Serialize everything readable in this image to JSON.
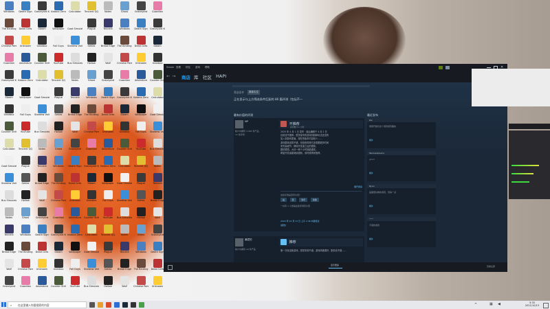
{
  "colors": {
    "steam_bg": "#1b2838",
    "steam_dark": "#171a21",
    "accent_red": "#c15755",
    "link_blue": "#66c0f4"
  },
  "desktop": {
    "icons": [
      {
        "label": "Windows",
        "color": "#4a7fc1"
      },
      {
        "label": "The Binding",
        "color": "#6a4a3a"
      },
      {
        "label": "Chinese Parents",
        "color": "#c44a4a"
      },
      {
        "label": "Guardian",
        "color": "#e87ca8"
      },
      {
        "label": "Graveyard Keeper",
        "color": "#3a3a3a"
      },
      {
        "label": "Steam",
        "color": "#1b2838"
      },
      {
        "label": "Gearbox",
        "color": "#333333"
      },
      {
        "label": "Counter Strike",
        "color": "#4a5a3a"
      },
      {
        "label": "Calculator",
        "color": "#ddddaa"
      },
      {
        "label": "Goat Simulator",
        "color": "#f0f0f0"
      },
      {
        "label": "Stardew Valley",
        "color": "#3a8fd8"
      },
      {
        "label": "Bus Simulator",
        "color": "#dddddd"
      },
      {
        "label": "Notes",
        "color": "#bbbbbb"
      },
      {
        "label": "Tencent",
        "color": "#3a3a6a"
      },
      {
        "label": "Bread Edge",
        "color": "#222222"
      },
      {
        "label": "Wolf",
        "color": "#e4e4e4"
      },
      {
        "label": "Graveyard",
        "color": "#444444"
      },
      {
        "label": "Death Sign",
        "color": "#3a7fc1"
      },
      {
        "label": "Dead Cells",
        "color": "#bb3333"
      },
      {
        "label": "Unknown",
        "color": "#ffcc33"
      },
      {
        "label": "Adventure",
        "color": "#2a5a9a"
      },
      {
        "label": "Katana Zero",
        "color": "#2a6ab0"
      },
      {
        "label": "Wallpaper",
        "color": "#111111"
      },
      {
        "label": "Fall Guys",
        "color": "#eeeeee"
      },
      {
        "label": "YouTube",
        "color": "#cc2b2b"
      },
      {
        "label": "Tencent QQ",
        "color": "#e0c030"
      },
      {
        "label": "Plague",
        "color": "#3a3a3a"
      },
      {
        "label": "Sekiro",
        "color": "#555555"
      },
      {
        "label": "Hollow",
        "color": "#222222"
      },
      {
        "label": "Ghost",
        "color": "#6aa0d0"
      }
    ]
  },
  "steam": {
    "topbar": {
      "items": [
        "Steam",
        "查看",
        "好友",
        "游戏",
        "帮助"
      ]
    },
    "nav": {
      "store": "商店",
      "library": "库",
      "community": "社区",
      "user": "HAPI"
    },
    "filter_label": "筛选条件",
    "filter_value": "简体中文",
    "filter_sentence": "正在显示与上方筛选条件匹配的 86 篇评测（包括不一",
    "section_most_helpful": "最有价值的评测",
    "section_recent": "最近发布",
    "review_main": {
      "user": "MP",
      "meta": "帐户内拥有 3,980 件产品",
      "sub_meta": "12 篇评测",
      "verdict": "不推荐",
      "hours": "总时数 0.1 小时",
      "body_lines": [
        "2020 年 4 月 1 日 发布 · 最后编辑于 4 月 2 日",
        "目前还不推荐，很多宣传的游戏机制和玩法还没有",
        "加入到游戏里面，现在的版本内容较少……",
        "游戏整体还算不错，但是我觉得它还需要更多时间",
        "来完善细节，期待开发者之后的更新。",
        "剧情很短，大约一两个小时就能通关。",
        "希望开发者能继续更新，到时候再来推荐。"
      ],
      "helpful_q": "这篇评测是否有价值？",
      "yes": "是",
      "no": "否",
      "funny": "欢乐",
      "award": "奖励",
      "read_more": "展开阅读",
      "footer_link": "一共有 1 人觉得这篇评测有价值",
      "date_footer": "2020 年 10 月 13 日 上午 2:46 内容经过",
      "report": "[报告]"
    },
    "review_second": {
      "user": "暴君的",
      "verdict": "推荐",
      "meta": "帐户内拥有 44 件产品",
      "body": "第一次玩这款游戏，感觉非常不错，游戏风格很好，剧情也不错……"
    },
    "recent": [
      {
        "user": "Koi",
        "line": "刚刚开始玩这个游戏挺有趣的",
        "verdict": "推荐"
      },
      {
        "user": "Tenrirenkoumo",
        "line": "good",
        "verdict": "推荐"
      },
      {
        "user": "Ryuu",
        "line": "画面很好看的游戏，值得一试",
        "verdict": "推荐"
      },
      {
        "user": "一一",
        "line": "不错的游戏",
        "verdict": "推荐"
      }
    ],
    "show_more": "显示更多",
    "community_label": "查看全部"
  },
  "taskbar": {
    "search_placeholder": "在这里输入你要搜索的内容",
    "time": "5:35",
    "date": "2021/10/13"
  }
}
